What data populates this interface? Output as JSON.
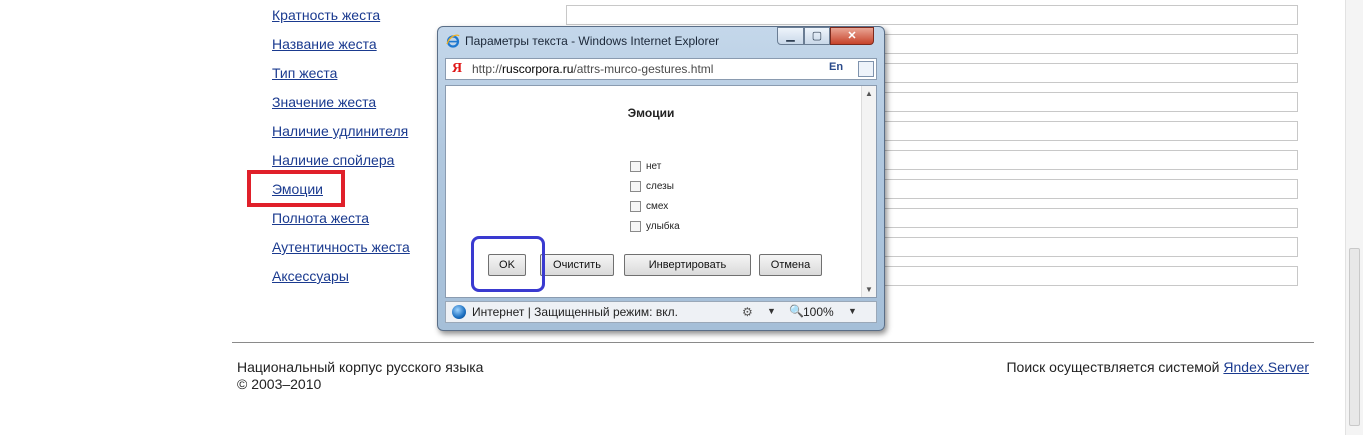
{
  "attributes": {
    "links": [
      "Кратность жеста",
      "Название жеста",
      "Тип жеста",
      "Значение жеста",
      "Наличие удлинителя",
      "Наличие спойлера",
      "Эмоции",
      "Полнота жеста",
      "Аутентичность жеста",
      "Аксессуары"
    ]
  },
  "footer": {
    "corpus_name": "Национальный корпус русского языка",
    "copyright": "© 2003–2010",
    "search_prefix": "Поиск осуществляется системой ",
    "search_engine_link": "Яndex.Server"
  },
  "popup": {
    "window_title": "Параметры текста - Windows Internet Explorer",
    "title_icon": "ie-logo-icon",
    "window_buttons": {
      "minimize": "minimize-icon",
      "maximize": "maximize-icon",
      "close": "close-icon"
    },
    "address": {
      "url_prefix": "http://",
      "url_domain": "ruscorpora.ru",
      "url_path": "/attrs-murco-gestures.html",
      "yandex_letter": "Я",
      "lang_label": "En"
    },
    "dialog": {
      "title": "Эмоции",
      "options": [
        {
          "label": "нет",
          "checked": false
        },
        {
          "label": "слезы",
          "checked": false
        },
        {
          "label": "смех",
          "checked": false
        },
        {
          "label": "улыбка",
          "checked": false
        }
      ],
      "buttons": {
        "ok": "OK",
        "clear": "Очистить",
        "invert": "Инвертировать",
        "cancel": "Отмена"
      }
    },
    "status": {
      "zone_text": "Интернет | Защищенный режим: вкл.",
      "zoom": "100%"
    }
  },
  "colors": {
    "link": "#1a3a8f",
    "highlight_red": "#e0202a",
    "highlight_blue": "#3a3ad0"
  }
}
